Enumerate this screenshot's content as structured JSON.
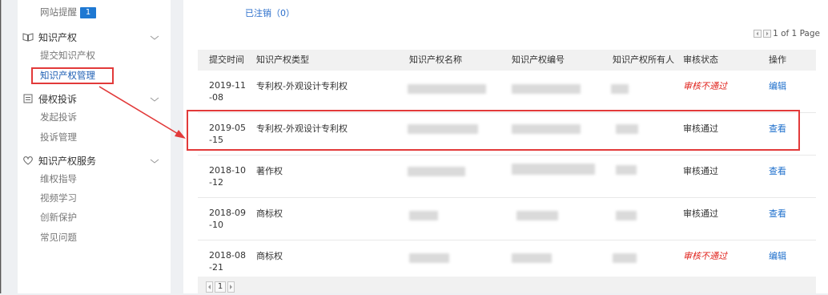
{
  "sidebar": {
    "site_reminder": {
      "label": "网站提醒",
      "badge": "1"
    },
    "ip_section": {
      "title": "知识产权",
      "icon": "book-icon",
      "items": [
        {
          "label": "提交知识产权"
        },
        {
          "label": "知识产权管理",
          "active": true
        }
      ]
    },
    "complaint_section": {
      "title": "侵权投诉",
      "icon": "document-icon",
      "items": [
        {
          "label": "发起投诉"
        },
        {
          "label": "投诉管理"
        }
      ]
    },
    "service_section": {
      "title": "知识产权服务",
      "icon": "heart-icon",
      "items": [
        {
          "label": "维权指导"
        },
        {
          "label": "视频学习"
        },
        {
          "label": "创新保护"
        },
        {
          "label": "常见问题"
        }
      ]
    }
  },
  "main": {
    "cancelled_link": "已注销（0）",
    "pager_top": "1 of 1 Page",
    "table": {
      "headers": [
        "提交时间",
        "知识产权类型",
        "知识产权名称",
        "知识产权编号",
        "知识产权所有人",
        "审核状态",
        "操作"
      ],
      "rows": [
        {
          "date": "2019-11-08",
          "type": "专利权-外观设计专利权",
          "status": "审核不通过",
          "status_kind": "rejected",
          "action": "编辑"
        },
        {
          "date": "2019-05-15",
          "type": "专利权-外观设计专利权",
          "status": "审核通过",
          "status_kind": "approved",
          "action": "查看"
        },
        {
          "date": "2018-10-12",
          "type": "著作权",
          "status": "审核通过",
          "status_kind": "approved",
          "action": "查看"
        },
        {
          "date": "2018-09-10",
          "type": "商标权",
          "status": "审核通过",
          "status_kind": "approved",
          "action": "查看"
        },
        {
          "date": "2018-08-21",
          "type": "商标权",
          "status": "审核不通过",
          "status_kind": "rejected",
          "action": "编辑"
        }
      ]
    },
    "pager_bottom": {
      "page": "1"
    }
  },
  "colors": {
    "accent": "#1e78d2",
    "link": "#1e6fcc",
    "rejected": "#e0251f",
    "annotation": "#e23a3a"
  }
}
